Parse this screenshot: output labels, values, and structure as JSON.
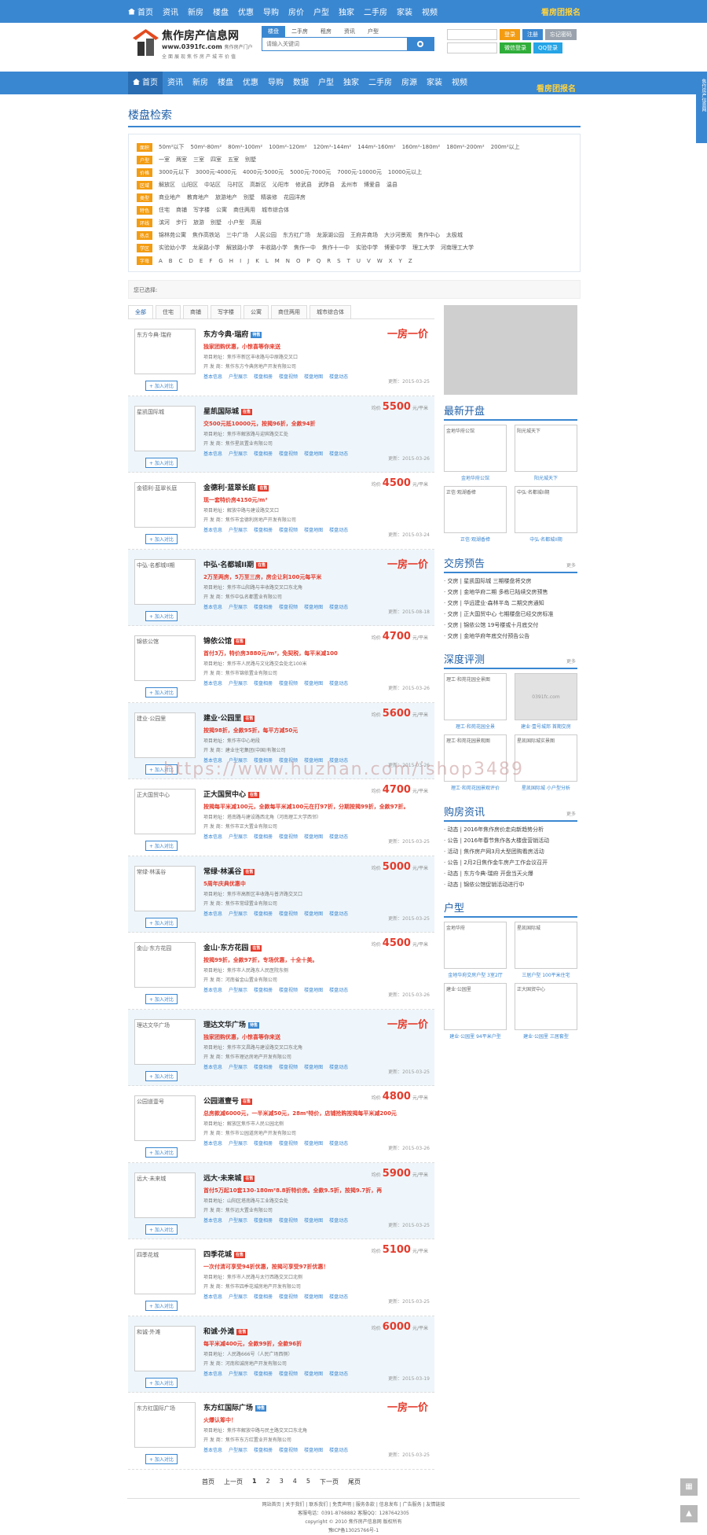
{
  "topnav": {
    "items": [
      "首页",
      "资讯",
      "新房",
      "楼盘",
      "优惠",
      "导购",
      "房价",
      "户型",
      "独家",
      "二手房",
      "家装",
      "视频"
    ],
    "signup": "看房团报名"
  },
  "header": {
    "logo_title": "焦作房产信息网",
    "logo_url": "www.0391fc.com",
    "logo_sub": "焦作房产门户",
    "logo_slogan": "全面展现焦作房产城市价值",
    "search_tabs": [
      "楼盘",
      "二手房",
      "租房",
      "资讯",
      "户型"
    ],
    "search_placeholder": "请输入关键词",
    "login": {
      "btn_login": "登录",
      "btn_register": "注册",
      "btn_forgot": "忘记密码",
      "btn_wechat": "微信登录",
      "btn_qq": "QQ登录"
    }
  },
  "mainnav": {
    "items": [
      "首页",
      "资讯",
      "新房",
      "楼盘",
      "优惠",
      "导购",
      "数据",
      "户型",
      "独家",
      "二手房",
      "房源",
      "家装",
      "视频"
    ],
    "signup": "看房团报名"
  },
  "search_section": {
    "title": "楼盘检索",
    "rows": [
      {
        "tag": "面积",
        "items": [
          "50m²以下",
          "50m²-80m²",
          "80m²-100m²",
          "100m²-120m²",
          "120m²-144m²",
          "144m²-160m²",
          "160m²-180m²",
          "180m²-200m²",
          "200m²以上"
        ]
      },
      {
        "tag": "户型",
        "items": [
          "一室",
          "两室",
          "三室",
          "四室",
          "五室",
          "别墅"
        ]
      },
      {
        "tag": "价格",
        "items": [
          "3000元以下",
          "3000元-4000元",
          "4000元-5000元",
          "5000元-7000元",
          "7000元-10000元",
          "10000元以上"
        ]
      },
      {
        "tag": "区域",
        "items": [
          "解放区",
          "山阳区",
          "中站区",
          "马村区",
          "高新区",
          "沁阳市",
          "修武县",
          "武陟县",
          "孟州市",
          "博爱县",
          "温县"
        ]
      },
      {
        "tag": "类型",
        "items": [
          "商业地产",
          "教育地产",
          "旅游地产",
          "别墅",
          "精装修",
          "花园洋房"
        ]
      },
      {
        "tag": "特色",
        "items": [
          "住宅",
          "商铺",
          "写字楼",
          "公寓",
          "商住两用",
          "城市综合体"
        ]
      },
      {
        "tag": "环线",
        "items": [
          "滨河",
          "步行",
          "旅游",
          "别墅",
          "小户型",
          "高层"
        ]
      },
      {
        "tag": "热点",
        "items": [
          "锦林苑公寓",
          "焦作高铁站",
          "三中广场",
          "人民公园",
          "东方红广场",
          "龙源湖公园",
          "王府井商场",
          "大沙河景观",
          "焦作中心",
          "太极城"
        ]
      },
      {
        "tag": "学区",
        "items": [
          "实验幼小学",
          "龙泉路小学",
          "解放路小学",
          "丰收路小学",
          "焦作一中",
          "焦作十一中",
          "实验中学",
          "博爱中学",
          "理工大学",
          "河南理工大学"
        ]
      },
      {
        "tag": "字母",
        "items": [
          "A",
          "B",
          "C",
          "D",
          "E",
          "F",
          "G",
          "H",
          "I",
          "J",
          "K",
          "L",
          "M",
          "N",
          "O",
          "P",
          "Q",
          "R",
          "S",
          "T",
          "U",
          "V",
          "W",
          "X",
          "Y",
          "Z"
        ]
      }
    ],
    "chosen_label": "您已选择:"
  },
  "list_tabs": [
    "全部",
    "住宅",
    "商铺",
    "写字楼",
    "公寓",
    "商住两用",
    "城市综合体"
  ],
  "listings": [
    {
      "name": "东方今典·瑞府",
      "badge": "待售",
      "badge_type": "wait",
      "promo": "独家团购优惠，小惊喜等你来送",
      "addr": "项目地址：焦作市新区丰收路与中原路交叉口",
      "dev": "开 发 商：焦作东方今典房地产开发有限公司",
      "price_label": "一房一价",
      "price": "",
      "unit": "",
      "date": "更新：2015-03-25"
    },
    {
      "name": "星凯国际城",
      "badge": "在售",
      "badge_type": "sale",
      "promo": "交500元抵10000元，按揭96折，全款94折",
      "addr": "项目地址：焦作市解放路与迎宾路交汇处",
      "dev": "开 发 商：焦作星凯置业有限公司",
      "price_label": "均价",
      "price": "5500",
      "unit": "元/平米",
      "date": "更新：2015-03-26"
    },
    {
      "name": "金德利·蓝翠长庭",
      "badge": "在售",
      "badge_type": "sale",
      "promo": "现一套特价房4150元/m²",
      "addr": "项目地址：解放中路与建设路交叉口",
      "dev": "开 发 商：焦作市金德利房地产开发有限公司",
      "price_label": "均价",
      "price": "4500",
      "unit": "元/平米",
      "date": "更新：2015-03-24"
    },
    {
      "name": "中弘·名都城II期",
      "badge": "在售",
      "badge_type": "sale",
      "promo": "2万至两房，5万至三房，房企让利100元每平米",
      "addr": "项目地址：焦作市山阳路与丰收路交叉口东北角",
      "dev": "开 发 商：焦作中弘名都置业有限公司",
      "price_label": "一房一价",
      "price": "",
      "unit": "",
      "date": "更新：2015-08-18"
    },
    {
      "name": "锦依公馆",
      "badge": "在售",
      "badge_type": "sale",
      "promo": "首付3万，特价房3880元/m²，免契税，每平米减100",
      "addr": "项目地址：焦作市人民路与文化路交会处北100米",
      "dev": "开 发 商：焦作市锦依置业有限公司",
      "price_label": "均价",
      "price": "4700",
      "unit": "元/平米",
      "date": "更新：2015-03-26"
    },
    {
      "name": "建业·公园里",
      "badge": "在售",
      "badge_type": "sale",
      "promo": "按揭98折，全款95折，每平方减50元",
      "addr": "项目地址：焦作市中心地段",
      "dev": "开 发 商：建业住宅集团(中国)有限公司",
      "price_label": "均价",
      "price": "5600",
      "unit": "元/平米",
      "date": "更新：2015-03-26"
    },
    {
      "name": "正大国贸中心",
      "badge": "在售",
      "badge_type": "sale",
      "promo": "按揭每平米减100元，全款每平米减100元在打97折，分期按揭99折，全款97折。",
      "addr": "项目地址：塔南路与建设路西北角（河南理工大学西邻）",
      "dev": "开 发 商：焦作市正大置业有限公司",
      "price_label": "均价",
      "price": "4700",
      "unit": "元/平米",
      "date": "更新：2015-03-25"
    },
    {
      "name": "常绿·林溪谷",
      "badge": "在售",
      "badge_type": "sale",
      "promo": "5周年庆典优惠中",
      "addr": "项目地址：焦作市高新区丰收路与普济路交叉口",
      "dev": "开 发 商：焦作市常绿置业有限公司",
      "price_label": "均价",
      "price": "5000",
      "unit": "元/平米",
      "date": "更新：2015-03-25"
    },
    {
      "name": "金山·东方花园",
      "badge": "在售",
      "badge_type": "sale",
      "promo": "按揭99折，全款97折，专场优惠，十全十美。",
      "addr": "项目地址：焦作市人民路东人民医院东侧",
      "dev": "开 发 商：河南省金山置业有限公司",
      "price_label": "均价",
      "price": "4500",
      "unit": "元/平米",
      "date": "更新：2015-03-26"
    },
    {
      "name": "理达文华广场",
      "badge": "待售",
      "badge_type": "wait",
      "promo": "独家团购优惠，小惊喜等你来送",
      "addr": "项目地址：焦作市文昌路与建设路交叉口东北角",
      "dev": "开 发 商：焦作市理达房地产开发有限公司",
      "price_label": "一房一价",
      "price": "",
      "unit": "",
      "date": "更新：2015-03-25"
    },
    {
      "name": "公园道壹号",
      "badge": "在售",
      "badge_type": "sale",
      "promo": "总房款减6000元，一半米减50元，28m²特价，店铺抢购按揭每平米减200元",
      "addr": "项目地址：解放区焦作市人民公园北侧",
      "dev": "开 发 商：焦作市公园道房地产开发有限公司",
      "price_label": "均价",
      "price": "4800",
      "unit": "元/平米",
      "date": "更新：2015-03-26"
    },
    {
      "name": "远大·未来城",
      "badge": "在售",
      "badge_type": "sale",
      "promo": "首付5万起10套130-180m²8.8折特价房。全款9.5折，按揭9.7折，再",
      "addr": "项目地址：山阳区塔南路与工业路交会处",
      "dev": "开 发 商：焦作远大置业有限公司",
      "price_label": "均价",
      "price": "5900",
      "unit": "元/平米",
      "date": "更新：2015-03-25"
    },
    {
      "name": "四季花城",
      "badge": "在售",
      "badge_type": "sale",
      "promo": "一次付清可享受94折优惠，按揭可享受97折优惠！",
      "addr": "项目地址：焦作市人民路与太行西路交叉口北侧",
      "dev": "开 发 商：焦作市四季花城房地产开发有限公司",
      "price_label": "均价",
      "price": "5100",
      "unit": "元/平米",
      "date": "更新：2015-03-25"
    },
    {
      "name": "和诚·外滩",
      "badge": "在售",
      "badge_type": "sale",
      "promo": "每平米减400元，全款99折，全款96折",
      "addr": "项目地址：人民路666号（人民广场西侧）",
      "dev": "开 发 商：河南和诚房地产开发有限公司",
      "price_label": "均价",
      "price": "6000",
      "unit": "元/平米",
      "date": "更新：2015-03-19"
    },
    {
      "name": "东方红国际广场",
      "badge": "待售",
      "badge_type": "wait",
      "promo": "火爆认筹中！",
      "addr": "项目地址：焦作市解放中路与民主路交叉口东北角",
      "dev": "开 发 商：焦作市东方红置业开发有限公司",
      "price_label": "一房一价",
      "price": "",
      "unit": "",
      "date": "更新：2015-03-25"
    }
  ],
  "listing_actions": [
    "基本信息",
    "户型展示",
    "楼盘相册",
    "楼盘视频",
    "楼盘地图",
    "楼盘动态"
  ],
  "compare_label": "加入对比",
  "pager": [
    "首页",
    "上一页",
    "1",
    "2",
    "3",
    "4",
    "5",
    "下一页",
    "尾页"
  ],
  "right": {
    "new_title": "最新开盘",
    "new_items": [
      {
        "img": "金地华府公馆",
        "cap": "金地华府公馆"
      },
      {
        "img": "阳光城天下",
        "cap": "阳光城天下"
      },
      {
        "img": "正信·观湖香樟",
        "cap": "正信·观湖香樟"
      },
      {
        "img": "中弘·名都城II期",
        "cap": "中弘·名都城II期"
      }
    ],
    "presale_title": "交房预告",
    "more": "更多",
    "presale_list": [
      "交房 | 星凯国际城 三期楼盘将交房",
      "交房 | 金地华府二期 多栋已陆续交房预售",
      "交房 | 华远建业·森林半岛 二期交房通知",
      "交房 | 正大国贸中心 七期楼盘已经交房标准",
      "交房 | 锦依公馆 19号楼或十月底交付",
      "交房 | 金地华府年底交付预告公告"
    ],
    "review_title": "深度评测",
    "review_items": [
      {
        "img": "理工·和苑花园全景图",
        "cap": "理工·和苑花园全景",
        "ph": false
      },
      {
        "img": "0391fc.com",
        "cap": "建业·壹号城邦 首期交房",
        "ph": true
      },
      {
        "img": "理工·和苑花园景观图",
        "cap": "理工·和苑花园景观评价",
        "ph": false
      },
      {
        "img": "星凯国际城实景图",
        "cap": "星凯国际城 小户型分析",
        "ph": false
      }
    ],
    "news_title": "购房资讯",
    "news_list": [
      "动态 | 2016年焦作房价走向新趋势分析",
      "公告 | 2016年春节焦作各大楼盘营销活动",
      "活动 | 焦作房产网3月大型团购看房活动",
      "公告 | 2月2日焦作金牛房产工作会议召开",
      "动态 | 东方今典·瑞府 开盘当天火爆",
      "动态 | 锦依公馆促销活动进行中"
    ],
    "type_title": "户型",
    "type_items": [
      {
        "img": "金地华府",
        "cap": "金地华府交房户型 3室2厅"
      },
      {
        "img": "星凯国际城",
        "cap": "三居户型 100平米住宅"
      },
      {
        "img": "建业·公园里",
        "cap": "建业·公园里 94平米户型"
      },
      {
        "img": "正大国贸中心",
        "cap": "建业·公园里 三居套型"
      }
    ]
  },
  "footer": {
    "links": "网站首页 | 关于我们 | 联系我们 | 免责声明 | 服务条款 | 信息发布 | 广告服务 | 友情链接",
    "contact": "客服电话：0391-8768882  客服QQ：1287642305",
    "copyright": "copyright © 2010 焦作房产信息网 版权所有",
    "icp": "豫ICP备13025766号-1"
  },
  "watermark": "https://www.huzhan.com/ishop3489",
  "side_tab": "焦作房产信息网",
  "colors": {
    "brand": "#3a87d1",
    "price": "#e53b2c",
    "tag": "#f39c12",
    "signup": "#ffd33d"
  }
}
